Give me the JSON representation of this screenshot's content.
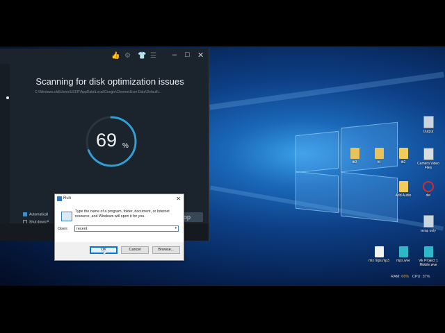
{
  "app": {
    "scan_title": "Scanning for disk optimization issues",
    "scan_path": "C:\\Windows.old\\Users\\USER\\AppData\\Local\\Google\\Chrome\\User Data\\Default\\...",
    "progress_value": "69",
    "progress_unit": "%",
    "progress_fraction": 0.69,
    "option_1": "Automaticall",
    "option_2": "Shut down P",
    "stop_label": "op",
    "accent_color": "#2f9fd6"
  },
  "run_dialog": {
    "title": "Run",
    "description": "Type the name of a program, folder, document, or Internet resource, and Windows will open it for you.",
    "open_label": "Open:",
    "open_value": "recent",
    "ok_label": "OK",
    "cancel_label": "Cancel",
    "browse_label": "Browse..."
  },
  "desktop_icons": [
    {
      "label": "Output",
      "icon": "printer-icon"
    },
    {
      "label": "ttt3",
      "icon": "folder-zip-icon"
    },
    {
      "label": "ttt",
      "icon": "folder-zip-icon"
    },
    {
      "label": "ttt2",
      "icon": "folder-icon"
    },
    {
      "label": "Camera Video Files",
      "icon": "camera-folder-icon"
    },
    {
      "label": "Add Audio",
      "icon": "folder-icon"
    },
    {
      "label": "del",
      "icon": "no-entry-icon"
    },
    {
      "label": "temp only",
      "icon": "printer-icon"
    },
    {
      "label": "mix mps.mp3",
      "icon": "audio-file-icon"
    },
    {
      "label": "mps.wve",
      "icon": "video-project-icon"
    },
    {
      "label": "VE Project 1 Mobile.wve",
      "icon": "video-project-icon"
    }
  ],
  "tray": {
    "ram_label": "RAM:",
    "ram_value": "66%",
    "cpu_label": "CPU:",
    "cpu_value": "37%"
  }
}
